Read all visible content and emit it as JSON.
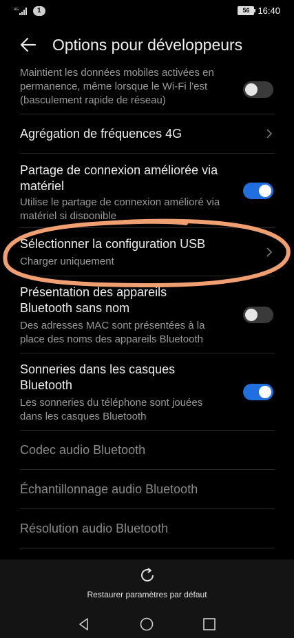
{
  "status_bar": {
    "notification_count": "1",
    "battery": "56",
    "time": "16:40"
  },
  "header": {
    "title": "Options pour développeurs"
  },
  "settings": [
    {
      "title": "",
      "subtitle": "Maintient les données mobiles activées en permanence, même lorsque le Wi-Fi l'est (basculement rapide de réseau)",
      "control": "toggle",
      "state": "off"
    },
    {
      "title": "Agrégation de fréquences 4G",
      "subtitle": "",
      "control": "chevron"
    },
    {
      "title": "Partage de connexion améliorée via matériel",
      "subtitle": "Utilise le partage de connexion amélioré via matériel si disponible",
      "control": "toggle",
      "state": "on"
    },
    {
      "title": "Sélectionner la configuration USB",
      "subtitle": "Charger uniquement",
      "control": "chevron"
    },
    {
      "title": "Présentation des appareils Bluetooth sans nom",
      "subtitle": "Des adresses MAC sont présentées à la place des noms des appareils Bluetooth",
      "control": "toggle",
      "state": "off"
    },
    {
      "title": "Sonneries dans les casques Bluetooth",
      "subtitle": "Les sonneries du téléphone sont jouées dans les casques Bluetooth",
      "control": "toggle",
      "state": "on"
    },
    {
      "title": "Codec audio Bluetooth",
      "subtitle": "",
      "control": "none",
      "disabled": true
    },
    {
      "title": "Échantillonnage audio Bluetooth",
      "subtitle": "",
      "control": "none",
      "disabled": true
    },
    {
      "title": "Résolution audio Bluetooth",
      "subtitle": "",
      "control": "none",
      "disabled": true
    }
  ],
  "bottom": {
    "reset_label": "Restaurer paramètres par défaut"
  },
  "colors": {
    "background": "#000000",
    "toggle_on": "#1f6fde",
    "annotation": "#f0a070"
  }
}
